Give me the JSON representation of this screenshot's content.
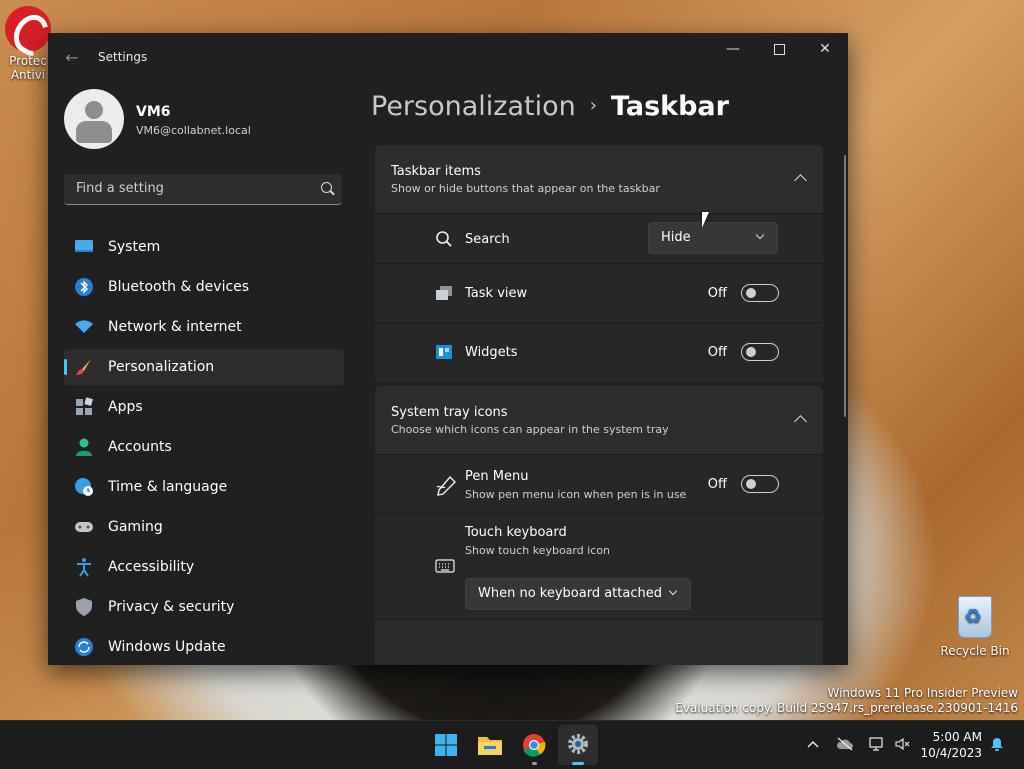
{
  "desktop": {
    "protected_label": "Protected\nAntivirus",
    "protected_label_visible": "Protec\nAntivi",
    "recycle_bin_label": "Recycle Bin",
    "watermark_line1": "Windows 11 Pro Insider Preview",
    "watermark_line2": "Evaluation copy. Build 25947.rs_prerelease.230901-1416"
  },
  "window": {
    "title": "Settings",
    "user": {
      "name": "VM6",
      "email": "VM6@collabnet.local"
    },
    "search_placeholder": "Find a setting"
  },
  "sidebar": {
    "items": [
      {
        "label": "System",
        "icon": "monitor-icon"
      },
      {
        "label": "Bluetooth & devices",
        "icon": "bluetooth-icon"
      },
      {
        "label": "Network & internet",
        "icon": "wifi-icon"
      },
      {
        "label": "Personalization",
        "icon": "brush-icon",
        "active": true
      },
      {
        "label": "Apps",
        "icon": "apps-icon"
      },
      {
        "label": "Accounts",
        "icon": "person-icon"
      },
      {
        "label": "Time & language",
        "icon": "globe-clock-icon"
      },
      {
        "label": "Gaming",
        "icon": "gamepad-icon"
      },
      {
        "label": "Accessibility",
        "icon": "accessibility-icon"
      },
      {
        "label": "Privacy & security",
        "icon": "shield-icon"
      },
      {
        "label": "Windows Update",
        "icon": "update-icon"
      }
    ]
  },
  "breadcrumb": {
    "parent": "Personalization",
    "separator": "›",
    "current": "Taskbar"
  },
  "sections": {
    "taskbar_items": {
      "title": "Taskbar items",
      "subtitle": "Show or hide buttons that appear on the taskbar",
      "search": {
        "label": "Search",
        "value": "Hide"
      },
      "task_view": {
        "label": "Task view",
        "state": "Off"
      },
      "widgets": {
        "label": "Widgets",
        "state": "Off"
      }
    },
    "system_tray": {
      "title": "System tray icons",
      "subtitle": "Choose which icons can appear in the system tray",
      "pen_menu": {
        "label": "Pen Menu",
        "subtitle": "Show pen menu icon when pen is in use",
        "state": "Off"
      },
      "touch_keyboard": {
        "label": "Touch keyboard",
        "subtitle": "Show touch keyboard icon",
        "value": "When no keyboard attached"
      }
    }
  },
  "taskbar": {
    "time": "5:00 AM",
    "date": "10/4/2023",
    "apps": [
      "start-icon",
      "file-explorer-icon",
      "chrome-icon",
      "settings-icon"
    ]
  },
  "colors": {
    "accent": "#4cc2ff",
    "window_bg": "#202020",
    "card_bg": "#2b2b2b"
  }
}
